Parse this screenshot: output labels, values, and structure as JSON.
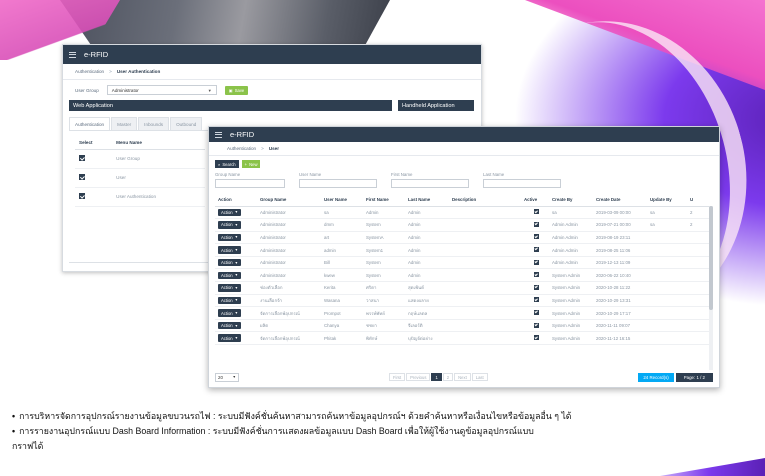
{
  "window1": {
    "app_title": "e-RFID",
    "breadcrumb": {
      "root": "Authentication",
      "separator": ">",
      "current": "User Authentication"
    },
    "user_group_label": "User Group",
    "user_group_value": "Administrator",
    "save_label": "Save",
    "panel_web": "Web Application",
    "panel_handheld": "Handheld Application",
    "tabs": [
      "Authentication",
      "Master",
      "Inbounds",
      "Outbound"
    ],
    "menu_table": {
      "headers": [
        "Select",
        "Menu Name"
      ],
      "rows": [
        {
          "name": "User Group",
          "checked": true
        },
        {
          "name": "User",
          "checked": true
        },
        {
          "name": "User Authentication",
          "checked": true
        }
      ]
    }
  },
  "window2": {
    "app_title": "e-RFID",
    "breadcrumb": {
      "root": "Authentication",
      "separator": ">",
      "current": "User"
    },
    "search_label": "Search",
    "new_label": "New",
    "filters": [
      "Group Name",
      "User Name",
      "First Name",
      "Last Name"
    ],
    "grid": {
      "headers": [
        "Action",
        "Group Name",
        "User Name",
        "First Name",
        "Last Name",
        "Description",
        "Active",
        "Create By",
        "Create Date",
        "Update By",
        "U"
      ],
      "action_label": "Action",
      "rows": [
        [
          "Administrator",
          "sa",
          "Admin",
          "Admin",
          "",
          "sa",
          "2019-03-09 00:00",
          "sa",
          "2"
        ],
        [
          "Administrator",
          "dmm",
          "System",
          "Admin",
          "",
          "Admin Admin",
          "2019-07-21 00:00",
          "sa",
          "2"
        ],
        [
          "Administrator",
          "art",
          "SystemA",
          "Admin",
          "",
          "Admin Admin",
          "2019-08-19 23:11",
          "",
          ""
        ],
        [
          "Administrator",
          "admin",
          "System1",
          "Admin",
          "",
          "Admin Admin",
          "2019-08-25 11:06",
          "",
          ""
        ],
        [
          "Administrator",
          "Bill",
          "System",
          "Admin",
          "",
          "Admin Admin",
          "2019-12-13 11:09",
          "",
          ""
        ],
        [
          "Administrator",
          "kwew",
          "System",
          "Admin",
          "",
          "System Admin",
          "2020-06-22 10:40",
          "",
          ""
        ],
        [
          "ช่องตัวเลือก",
          "Kerita",
          "ศริตา",
          "สุดเฟ้นต์",
          "",
          "System Admin",
          "2020-10-28 11:22",
          "",
          ""
        ],
        [
          "งานเลือกจ้า",
          "Wasana",
          "วาสนา",
          "แสดงผลาย",
          "",
          "System Admin",
          "2020-10-29 13:31",
          "",
          ""
        ],
        [
          "จัดการเลือกพ์อุปกรณ์",
          "Prompot",
          "พรรพ์พัทย์",
          "กฤษ์แลตล",
          "",
          "System Admin",
          "2020-10-29 17:17",
          "",
          ""
        ],
        [
          "ผลิต",
          "Chanya",
          "ชชยา",
          "จีเลอร์ติ",
          "",
          "System Admin",
          "2020-11-11 09:07",
          "",
          ""
        ],
        [
          "จัดการเลือกพ์อุปกรณ์",
          "Phitak",
          "พิทักษ์",
          "บุปัญจ์ต่อย่าง",
          "",
          "System Admin",
          "2020-11-12 16:15",
          "",
          ""
        ]
      ]
    },
    "page_size": "20",
    "pager": [
      "First",
      "Previous",
      "1",
      "2",
      "Next",
      "Last"
    ],
    "pager_current": "1",
    "records": "24 Record(s)",
    "page_info": "Page: 1 / 2"
  },
  "captions": [
    "การบริหารจัดการอุปกรณ์รายงานข้อมูลขบวนรถไฟ : ระบบมีฟังค์ชั่นค้นหาสามารถค้นหาข้อมูลอุปกรณ์ฯ ด้วยคำค้นหาหรือเงื่อนไขหรือข้อมูลอื่น ๆ ได้",
    "การรายงานอุปกรณ์แบบ Dash Board Information : ระบบมีฟังค์ชั่นการแสดงผลข้อมูลแบบ Dash Board เพื่อให้ผู้ใช้งานดูข้อมูลอุปกรณ์แบบ",
    "กราฟได้"
  ]
}
